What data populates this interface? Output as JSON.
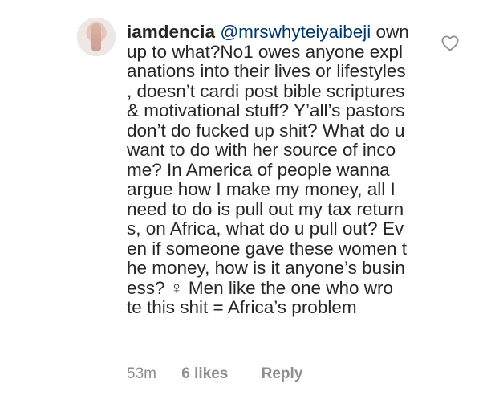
{
  "comment": {
    "username": "iamdencia",
    "mention": "@mrswhyteiyaibeji",
    "first_line_rest": " own",
    "lines": [
      "up to what?No1 owes anyone expl",
      "anations into their lives or lifestyles",
      ", doesn’t cardi post bible scriptures",
      "& motivational stuff? Y’all’s pastors",
      "don’t do fucked up shit? What do u",
      "want to do with her source of inco",
      "me? In America of people wanna",
      "argue how I make my money, all I",
      "need to do is pull out my tax return",
      "s, on Africa, what do u pull out? Ev",
      "en if someone gave these women t",
      "he money, how is it anyone’s busin",
      "ess?  ♀ Men like the one who wro",
      "te this shit = Africa’s problem"
    ],
    "time": "53m",
    "likes": "6 likes",
    "reply_label": "Reply",
    "avatar_icon": "avatar",
    "like_icon": "heart-outline-icon"
  }
}
